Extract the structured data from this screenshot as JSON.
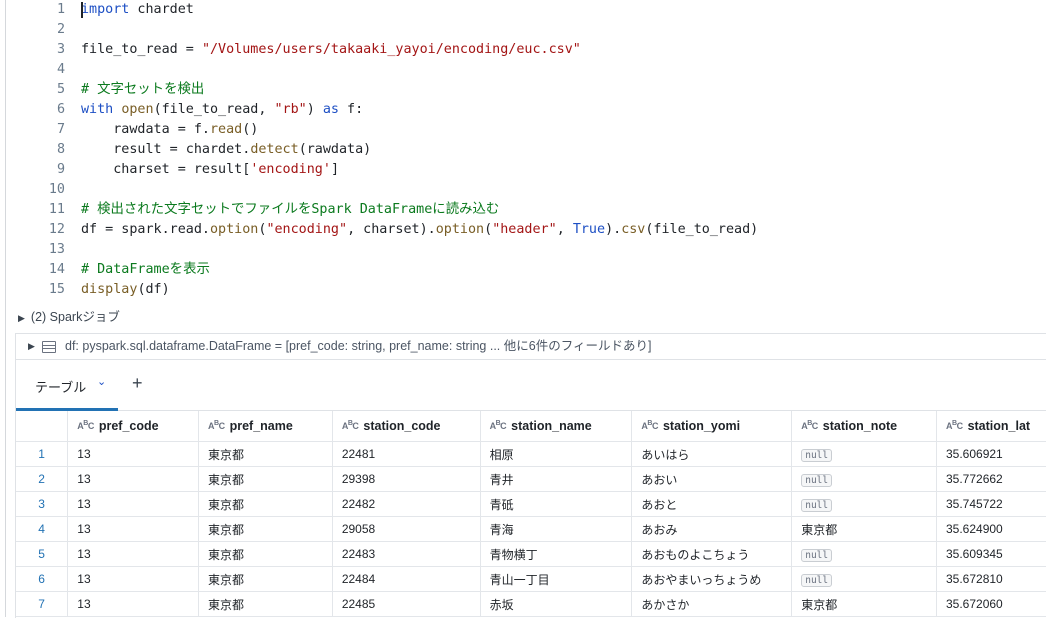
{
  "code_lines": [
    {
      "n": "1",
      "segs": [
        {
          "t": "import",
          "c": "kw"
        },
        {
          "t": " chardet"
        }
      ]
    },
    {
      "n": "2",
      "segs": []
    },
    {
      "n": "3",
      "segs": [
        {
          "t": "file_to_read = "
        },
        {
          "t": "\"/Volumes/users/takaaki_yayoi/encoding/euc.csv\"",
          "c": "str"
        }
      ]
    },
    {
      "n": "4",
      "segs": []
    },
    {
      "n": "5",
      "segs": [
        {
          "t": "# 文字セットを検出",
          "c": "cm"
        }
      ]
    },
    {
      "n": "6",
      "segs": [
        {
          "t": "with",
          "c": "kw"
        },
        {
          "t": " "
        },
        {
          "t": "open",
          "c": "fn"
        },
        {
          "t": "(file_to_read, "
        },
        {
          "t": "\"rb\"",
          "c": "str"
        },
        {
          "t": ") "
        },
        {
          "t": "as",
          "c": "kw"
        },
        {
          "t": " f:"
        }
      ]
    },
    {
      "n": "7",
      "segs": [
        {
          "t": "    rawdata = f."
        },
        {
          "t": "read",
          "c": "fn"
        },
        {
          "t": "()"
        }
      ]
    },
    {
      "n": "8",
      "segs": [
        {
          "t": "    result = chardet."
        },
        {
          "t": "detect",
          "c": "fn"
        },
        {
          "t": "(rawdata)"
        }
      ]
    },
    {
      "n": "9",
      "segs": [
        {
          "t": "    charset = result["
        },
        {
          "t": "'encoding'",
          "c": "str"
        },
        {
          "t": "]"
        }
      ]
    },
    {
      "n": "10",
      "segs": []
    },
    {
      "n": "11",
      "segs": [
        {
          "t": "# 検出された文字セットでファイルをSpark DataFrameに読み込む",
          "c": "cm"
        }
      ]
    },
    {
      "n": "12",
      "segs": [
        {
          "t": "df = spark.read."
        },
        {
          "t": "option",
          "c": "fn"
        },
        {
          "t": "("
        },
        {
          "t": "\"encoding\"",
          "c": "str"
        },
        {
          "t": ", charset)."
        },
        {
          "t": "option",
          "c": "fn"
        },
        {
          "t": "("
        },
        {
          "t": "\"header\"",
          "c": "str"
        },
        {
          "t": ", "
        },
        {
          "t": "True",
          "c": "kw"
        },
        {
          "t": ")."
        },
        {
          "t": "csv",
          "c": "fn"
        },
        {
          "t": "(file_to_read)"
        }
      ]
    },
    {
      "n": "13",
      "segs": []
    },
    {
      "n": "14",
      "segs": [
        {
          "t": "# DataFrameを表示",
          "c": "cm"
        }
      ]
    },
    {
      "n": "15",
      "segs": [
        {
          "t": "display",
          "c": "fn"
        },
        {
          "t": "(df)"
        }
      ]
    }
  ],
  "spark_jobs": {
    "label": "(2) Sparkジョブ"
  },
  "dataframe": {
    "label": "df:  pyspark.sql.dataframe.DataFrame = [pref_code: string, pref_name: string ... 他に6件のフィールドあり]"
  },
  "tabs": {
    "table_label": "テーブル",
    "add_label": "+"
  },
  "type_icon": {
    "main": "A",
    "sup": "B",
    "tail": "C"
  },
  "table": {
    "columns": [
      "pref_code",
      "pref_name",
      "station_code",
      "station_name",
      "station_yomi",
      "station_note",
      "station_lat"
    ],
    "rows": [
      [
        "1",
        "13",
        "東京都",
        "22481",
        "相原",
        "あいはら",
        "null",
        "35.606921"
      ],
      [
        "2",
        "13",
        "東京都",
        "29398",
        "青井",
        "あおい",
        "null",
        "35.772662"
      ],
      [
        "3",
        "13",
        "東京都",
        "22482",
        "青砥",
        "あおと",
        "null",
        "35.745722"
      ],
      [
        "4",
        "13",
        "東京都",
        "29058",
        "青海",
        "あおみ",
        "東京都",
        "35.624900"
      ],
      [
        "5",
        "13",
        "東京都",
        "22483",
        "青物横丁",
        "あおものよこちょう",
        "null",
        "35.609345"
      ],
      [
        "6",
        "13",
        "東京都",
        "22484",
        "青山一丁目",
        "あおやまいっちょうめ",
        "null",
        "35.672810"
      ],
      [
        "7",
        "13",
        "東京都",
        "22485",
        "赤坂",
        "あかさか",
        "東京都",
        "35.672060"
      ]
    ]
  }
}
